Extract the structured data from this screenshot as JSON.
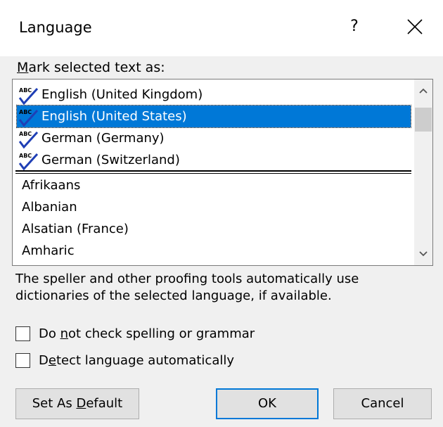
{
  "dialog": {
    "title": "Language",
    "help_label": "?"
  },
  "list": {
    "label_prefix": "M",
    "label_rest": "ark selected text as:",
    "items": [
      {
        "label": "English (United Kingdom)",
        "proofing": true,
        "selected": false
      },
      {
        "label": "English (United States)",
        "proofing": true,
        "selected": true
      },
      {
        "label": "German (Germany)",
        "proofing": true,
        "selected": false
      },
      {
        "label": "German (Switzerland)",
        "proofing": true,
        "selected": false
      },
      {
        "label": "Afrikaans",
        "proofing": false,
        "selected": false
      },
      {
        "label": "Albanian",
        "proofing": false,
        "selected": false
      },
      {
        "label": "Alsatian (France)",
        "proofing": false,
        "selected": false
      },
      {
        "label": "Amharic",
        "proofing": false,
        "selected": false
      }
    ],
    "icon": "abc-spellcheck-icon"
  },
  "description": "The speller and other proofing tools automatically use dictionaries of the selected language, if available.",
  "options": {
    "no_check": {
      "pre": "Do ",
      "key": "n",
      "post": "ot check spelling or grammar",
      "checked": false
    },
    "detect": {
      "pre": "D",
      "key": "e",
      "post": "tect language automatically",
      "checked": false
    }
  },
  "buttons": {
    "set_default": {
      "pre": "Set As ",
      "key": "D",
      "post": "efault"
    },
    "ok": "OK",
    "cancel": "Cancel"
  },
  "colors": {
    "selection": "#0078d7",
    "dialog_bg": "#f0f0f0",
    "check_blue": "#1f3fb5"
  }
}
